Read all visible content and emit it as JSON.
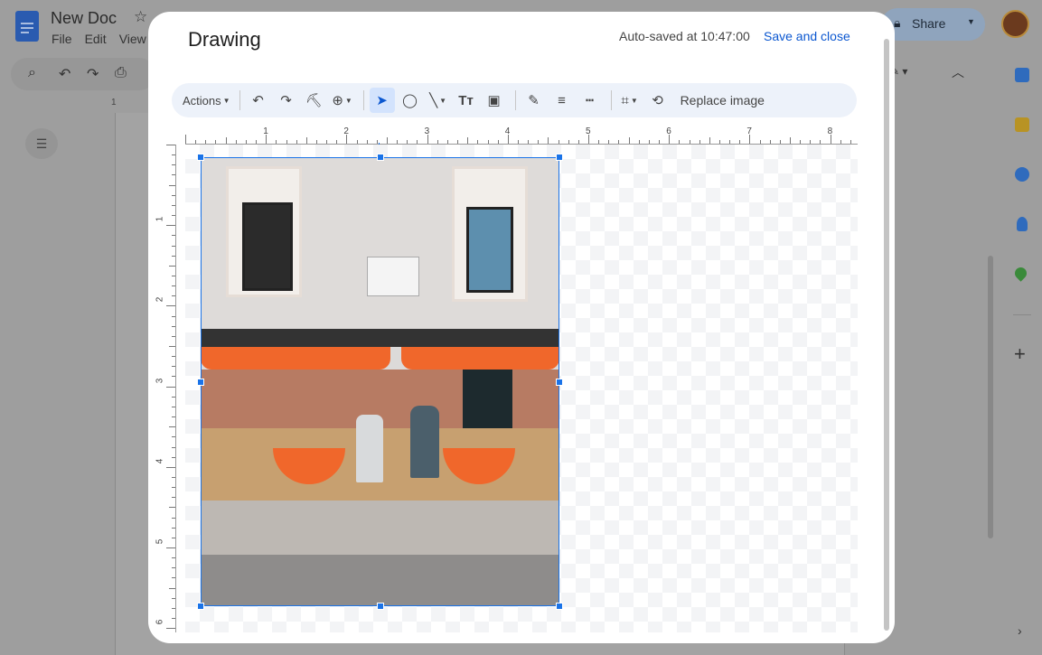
{
  "background": {
    "doc_title": "New Doc",
    "menu": [
      "File",
      "Edit",
      "View"
    ],
    "share_label": "Share",
    "ruler_mark": "1"
  },
  "dialog": {
    "title": "Drawing",
    "autosave": "Auto-saved at 10:47:00",
    "save_close": "Save and close",
    "toolbar": {
      "actions_label": "Actions",
      "replace_image_label": "Replace image"
    },
    "ruler_top": [
      "1",
      "2",
      "3",
      "4",
      "5",
      "6",
      "7",
      "8"
    ],
    "ruler_left": [
      "1",
      "2",
      "3",
      "4",
      "5",
      "6"
    ]
  },
  "colors": {
    "accent": "#1a73e8",
    "link": "#0b57d0",
    "awning": "#f0672b"
  }
}
